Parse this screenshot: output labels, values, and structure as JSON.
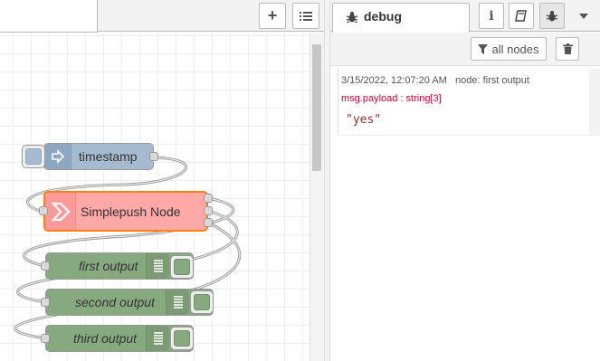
{
  "workspace": {
    "add_flow_icon": "plus-icon",
    "flow_list_icon": "list-icon",
    "nodes": {
      "timestamp": {
        "label": "timestamp",
        "type": "inject",
        "color": "#a6bbcf"
      },
      "simplepush": {
        "label": "Simplepush Node",
        "color": "#ffa8a8"
      },
      "first_output": {
        "label": "first output",
        "type": "debug",
        "color": "#87a980"
      },
      "second_output": {
        "label": "second output",
        "type": "debug",
        "color": "#87a980"
      },
      "third_output": {
        "label": "third output",
        "type": "debug",
        "color": "#87a980"
      }
    }
  },
  "sidebar": {
    "tab": {
      "label": "debug",
      "icon": "bug-icon"
    },
    "buttons": [
      "info-icon",
      "book-icon",
      "bug-icon",
      "caret-down-icon"
    ],
    "filter": {
      "label": "all nodes",
      "icon": "filter-icon"
    },
    "clear_icon": "trash-icon",
    "messages": [
      {
        "timestamp": "3/15/2022, 12:07:20 AM",
        "source": "node: first output",
        "topic": "msg.payload : string[3]",
        "value": "\"yes\""
      }
    ]
  }
}
